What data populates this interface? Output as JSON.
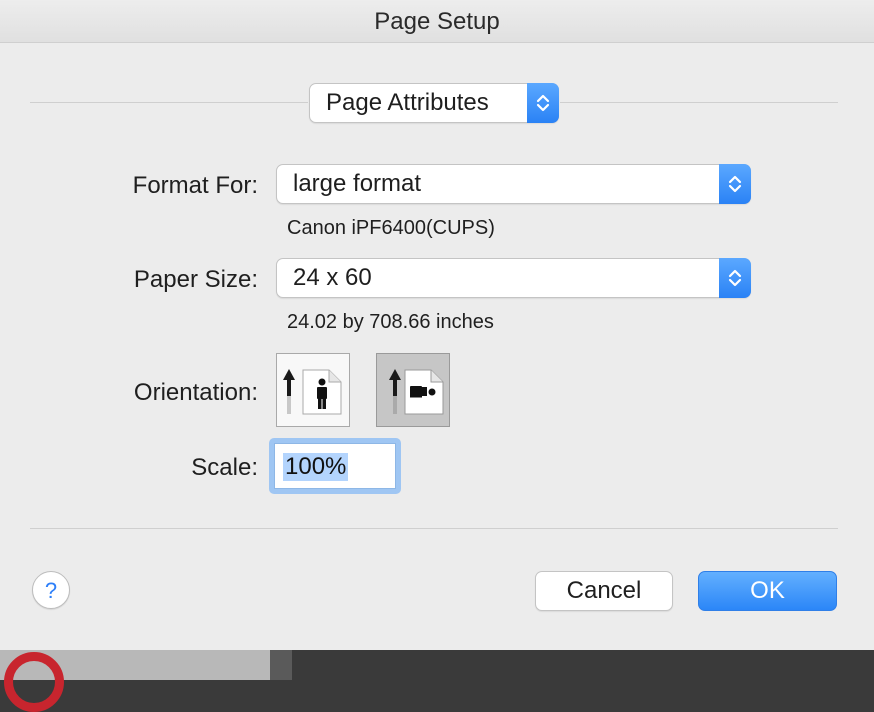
{
  "dialog": {
    "title": "Page Setup"
  },
  "settings_popup": {
    "value": "Page Attributes"
  },
  "format_for": {
    "label": "Format For:",
    "value": "large format",
    "printer": "Canon iPF6400(CUPS)"
  },
  "paper_size": {
    "label": "Paper Size:",
    "value": "24 x 60",
    "dimensions": "24.02 by 708.66 inches"
  },
  "orientation": {
    "label": "Orientation:",
    "options": [
      "portrait",
      "landscape"
    ],
    "selected": "landscape"
  },
  "scale": {
    "label": "Scale:",
    "value": "100%"
  },
  "buttons": {
    "help": "?",
    "cancel": "Cancel",
    "ok": "OK"
  },
  "colors": {
    "accent": "#2d86f7",
    "dialog_bg": "#ececec"
  },
  "icons": {
    "popup_arrows": "up-down-chevron-icon",
    "portrait": "portrait-orientation-icon",
    "landscape": "landscape-orientation-icon"
  }
}
